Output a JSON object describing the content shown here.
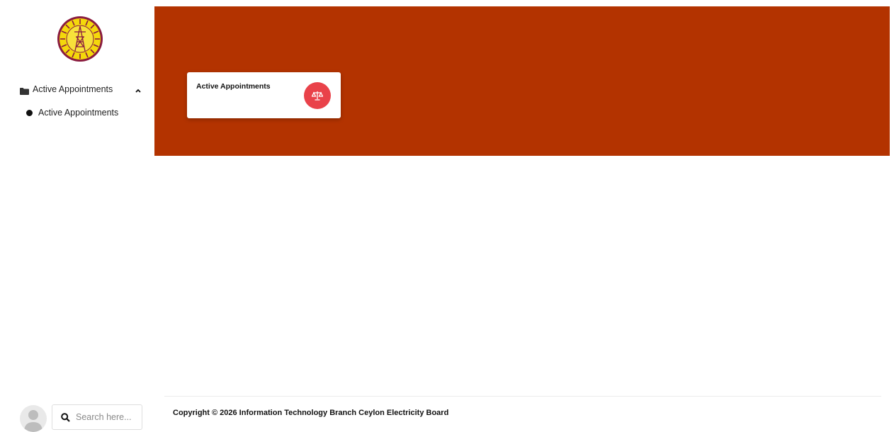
{
  "sidebar": {
    "logo_icon": "ceylon-electricity-board-logo",
    "nav_group": {
      "icon": "folder-icon",
      "label": "Active Appointments",
      "caret": "chevron-up-icon"
    },
    "nav_items": [
      {
        "icon": "dot-icon",
        "label": "Active Appointments"
      }
    ],
    "user": {
      "avatar_icon": "user-avatar-icon"
    },
    "search": {
      "icon": "search-icon",
      "placeholder": "Search here..."
    }
  },
  "hero": {
    "background_color": "#b33300"
  },
  "card": {
    "title": "Active Appointments",
    "badge_icon": "balance-scale-icon",
    "badge_color": "#e9424a"
  },
  "footer": {
    "copyright": "Copyright © 2026 Information Technology Branch Ceylon Electricity Board"
  }
}
